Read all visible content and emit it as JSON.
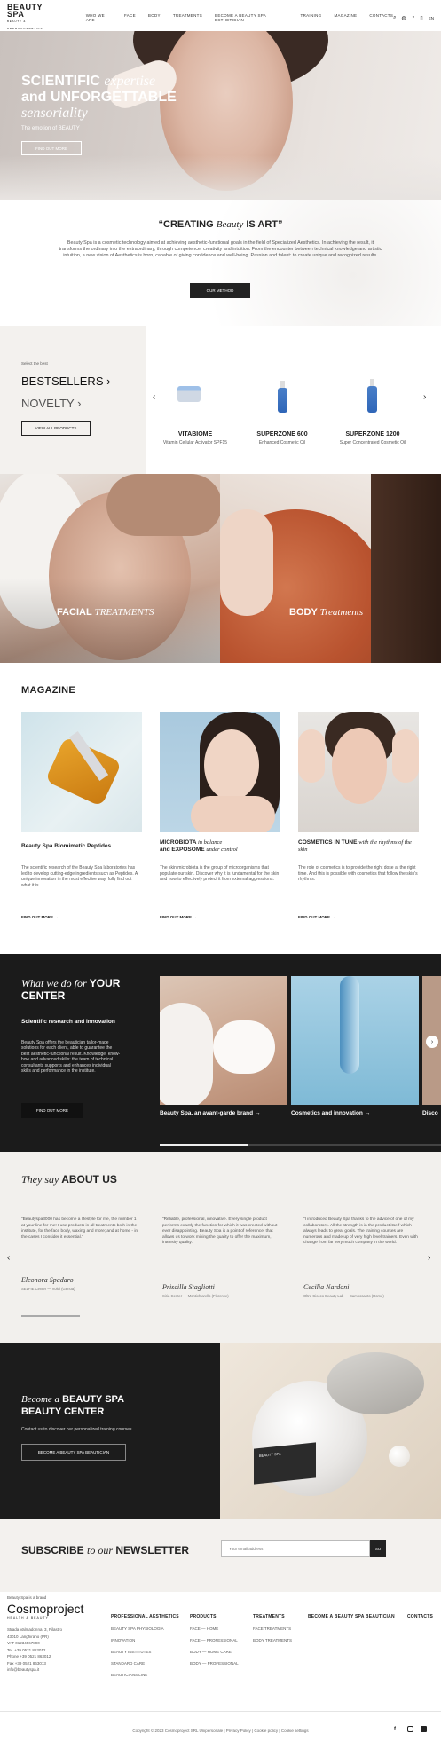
{
  "header": {
    "logo": "BEAUTY SPA",
    "logo_sub": "BEAUTY & DERMOCOSMETICS",
    "nav": [
      "WHO WE ARE",
      "FACE",
      "BODY",
      "TREATMENTS",
      "BECOME A BEAUTY SPA ESTHETICIAN",
      "TRAINING",
      "MAGAZINE",
      "CONTACTS"
    ],
    "lang": "EN"
  },
  "hero": {
    "line1": "SCIENTIFIC",
    "line1_italic": "expertise",
    "line2": "and UNFORGETTABLE",
    "line3_italic": "sensoriality",
    "sub": "The emotion of BEAUTY",
    "button": "FIND OUT MORE"
  },
  "intro": {
    "title_a": "“CREATING",
    "title_i": "Beauty",
    "title_b": "IS ART”",
    "text": "Beauty Spa is a cosmetic technology aimed at achieving aesthetic-functional goals in the field of Specialized Aesthetics. In achieving the result, it transforms the ordinary into the extraordinary, through competence, creativity and intuition. From the encounter between technical knowledge and artistic intuition, a new vision of Aesthetics is born, capable of giving confidence and well-being. Passion and talent: to create unique and recognized results.",
    "button": "OUR METHOD"
  },
  "products": {
    "kicker": "Select the best",
    "bestsellers": "BESTSELLERS",
    "novelty": "NOVELTY",
    "view_all": "VIEW ALL PRODUCTS",
    "items": [
      {
        "name": "VITABIOME",
        "desc": "Vitamin Cellular Activator SPF15"
      },
      {
        "name": "SUPERZONE 600",
        "desc": "Enhanced Cosmetic Oil"
      },
      {
        "name": "SUPERZONE 1200",
        "desc": "Super Concentrated Cosmetic Oil"
      }
    ]
  },
  "treatments": {
    "facial": "FACIAL",
    "facial_i": "TREATMENTS",
    "body": "BODY",
    "body_i": "Treatments"
  },
  "magazine": {
    "title": "MAGAZINE",
    "link": "FIND OUT MORE",
    "articles": [
      {
        "title": "Beauty Spa Biomimetic Peptides",
        "title_i": "",
        "text": "The scientific research of the Beauty Spa laboratories has led to develop cutting-edge ingredients such as Peptides. A unique innovation in the most effective way, fully find out what it is."
      },
      {
        "title": "MICROBIOTA",
        "title_i": "in balance",
        "title2": "and EXPOSOME",
        "title2_i": "under control",
        "text": "The skin microbiota is the group of microorganisms that populate our skin. Discover why it is fundamental for the skin and how to effectively protect it from external aggressions."
      },
      {
        "title": "COSMETICS IN TUNE",
        "title_i": "with the rhythms of the skin",
        "text": "The role of cosmetics is to provide the right dose at the right time. And this is possible with cosmetics that follow the skin's rhythms."
      }
    ]
  },
  "center": {
    "title_i": "What we do for",
    "title": "YOUR CENTER",
    "sub": "Scientific research and innovation",
    "text": "Beauty Spa offers the beautician tailor-made solutions for each client, able to guarantee the best aesthetic-functional result. Knowledge, know-how and advanced skills: the team of technical consultants supports and enhances individual skills and performance in the institute.",
    "button": "FIND OUT MORE",
    "cards": [
      "Beauty Spa, an avant-garde brand",
      "Cosmetics and innovation",
      "Disco"
    ]
  },
  "testimonials": {
    "title_i": "They say",
    "title": "ABOUT US",
    "items": [
      {
        "text": "“Beautyspa3000 has become a lifestyle for me, the number 1 at your line for me! I use products in all treatments both in the institute, for the face body, waxing and more; and at home - in the cases I consider it essential.”",
        "name": "Eleonora Spadaro",
        "role": "SELFIE Center — Voltri (Genoa)"
      },
      {
        "text": "“Reliable, professional, innovative. Every single product performs exactly the function for which it was created without ever disappointing. Beauty Spa is a point of reference, that allows us to work mixing the quality to offer the maximum, intensity quality.”",
        "name": "Priscilla Stagliotti",
        "role": "Siria Center — Montichiarello (Florence)"
      },
      {
        "text": "“I introduced Beauty Spa thanks to the advice of one of my collaborators. All the strength is in the product itself which always leads to great goals. The training courses are numerous and made up of very high level trainers. Even with change from far very much company in the world.”",
        "name": "Cecilia Nardoni",
        "role": "Oltre Ciocco Beauty Lab — Camposanto (Rome)"
      }
    ]
  },
  "become": {
    "title_i": "Become a",
    "title": "BEAUTY SPA",
    "title2": "BEAUTY CENTER",
    "sub": "Contact us to discover our personalized training courses",
    "button": "BECOME A BEAUTY SPA BEAUTICIAN",
    "jar_label": "BEAUTY SPA"
  },
  "newsletter": {
    "title": "SUBSCRIBE",
    "title_i": "to our",
    "title2": "NEWSLETTER",
    "placeholder": "Your email address",
    "button": "SU"
  },
  "footer": {
    "kicker": "Beauty Spa is a brand",
    "brand": "Cosmoproject",
    "brand_sub": "HEALTH & BEAUTY",
    "address": [
      "Strada Valmadonna, 3, Pilastro",
      "43010 Langhirano (PR)",
      "VAT 01234567890",
      "Tel. +39 0521 863012",
      "Phone +39 0521 863012",
      "Fax +39 0521 863013",
      "info@beautyspa.it"
    ],
    "columns": [
      {
        "head": "PROFESSIONAL AESTHETICS",
        "items": [
          "BEAUTY SPA PHYSIOLOGIA",
          "INNOVATION",
          "BEAUTY INSTITUTES",
          "STANDARD CARE",
          "BEAUTICIANS LINE"
        ]
      },
      {
        "head": "PRODUCTS",
        "items": [
          "FACE — HOME",
          "FACE — PROFESSIONAL",
          "BODY — HOME CARE",
          "BODY — PROFESSIONAL"
        ]
      },
      {
        "head": "TREATMENTS",
        "items": [
          "FACE TREATMENTS",
          "BODY TREATMENTS"
        ]
      },
      {
        "head": "BECOME A BEAUTY SPA BEAUTICIAN",
        "items": []
      },
      {
        "head": "CONTACTS",
        "items": []
      }
    ],
    "copyright": "Copyright © 2023 Cosmoproject SRL Unipersonale | Privacy Policy | Cookie policy | Cookie settings"
  },
  "colors": {
    "dark": "#1b1b1b",
    "accent_blue": "#2f66b8",
    "cream": "#f2f0ed"
  }
}
